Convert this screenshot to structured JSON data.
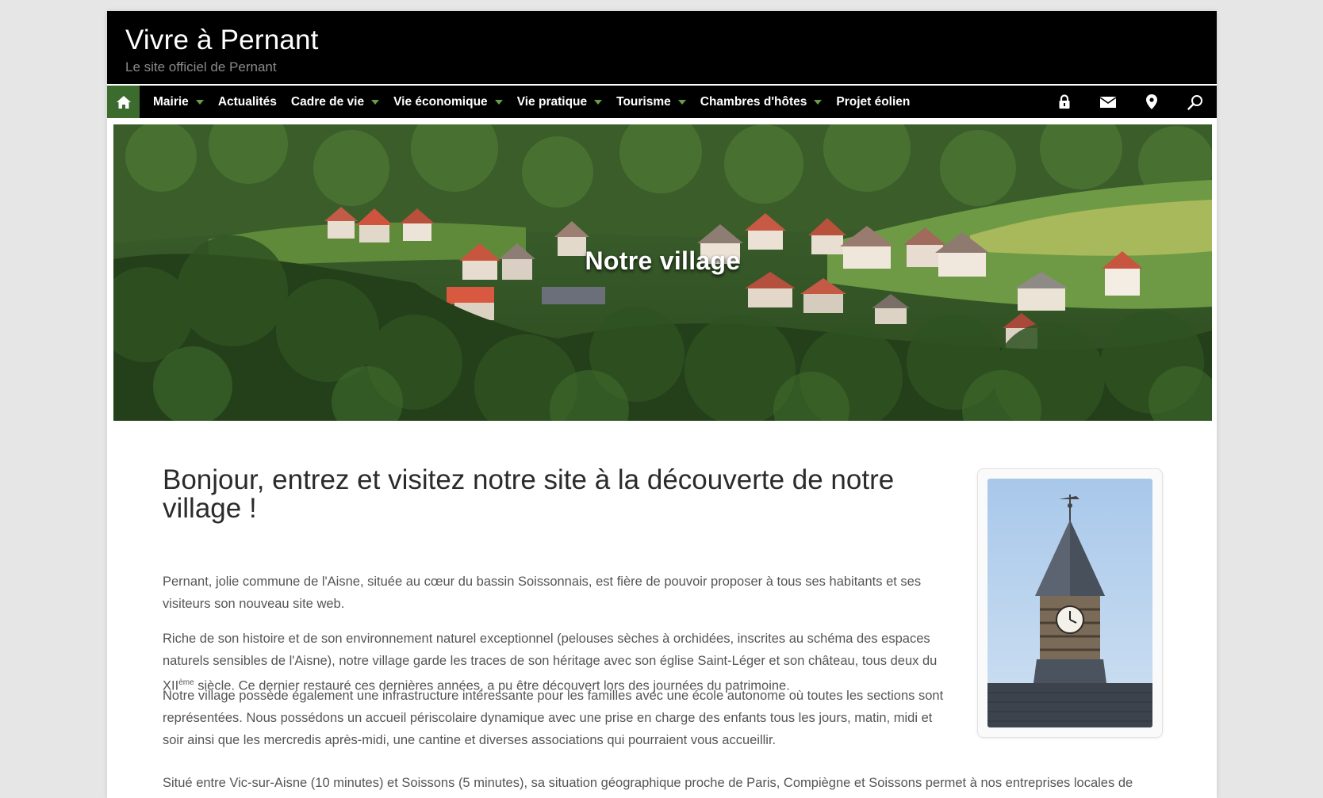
{
  "header": {
    "site_title": "Vivre à Pernant",
    "tagline": "Le site officiel de Pernant"
  },
  "nav": {
    "home_icon": "home-icon",
    "items": [
      {
        "label": "Mairie",
        "dropdown": true
      },
      {
        "label": "Actualités",
        "dropdown": false
      },
      {
        "label": "Cadre de vie",
        "dropdown": true
      },
      {
        "label": "Vie économique",
        "dropdown": true
      },
      {
        "label": "Vie pratique",
        "dropdown": true
      },
      {
        "label": "Tourisme",
        "dropdown": true
      },
      {
        "label": "Chambres d'hôtes",
        "dropdown": true
      },
      {
        "label": "Projet éolien",
        "dropdown": false
      }
    ],
    "tools": [
      "lock-icon",
      "mail-icon",
      "map-pin-icon",
      "search-icon"
    ]
  },
  "hero": {
    "title": "Notre village"
  },
  "content": {
    "heading": "Bonjour, entrez et visitez notre site à la découverte de notre village !",
    "p1": "Pernant, jolie commune de l'Aisne, située au cœur du bassin Soissonnais, est fière de pouvoir proposer à tous ses habitants et ses visiteurs son nouveau site web.",
    "p2_before": "Riche de son histoire et de son environnement naturel exceptionnel (pelouses sèches à orchidées, inscrites au schéma des espaces naturels sensibles de l'Aisne), notre village garde les traces de son héritage avec son église Saint-Léger et son château, tous deux du XII",
    "p2_sup": "ème",
    "p2_after": " siècle. Ce dernier restauré ces dernières années, a pu être découvert lors des journées du patrimoine.",
    "p3": "Notre village possède également une infrastructure intéressante pour les familles avec une école autonome où toutes les sections sont représentées. Nous possédons un accueil périscolaire dynamique avec une prise en charge des enfants tous les jours, matin, midi et soir ainsi que les mercredis après-midi, une cantine et diverses associations qui pourraient vous accueillir.",
    "p4": "Situé entre Vic-sur-Aisne (10 minutes) et Soissons (5 minutes), sa situation géographique proche de Paris, Compiègne et Soissons permet à nos entreprises locales de"
  },
  "colors": {
    "header_bg": "#000000",
    "nav_home_bg": "#3b6b2d",
    "caret": "#6a9b4a",
    "text": "#555555",
    "heading": "#2b2b2b"
  }
}
